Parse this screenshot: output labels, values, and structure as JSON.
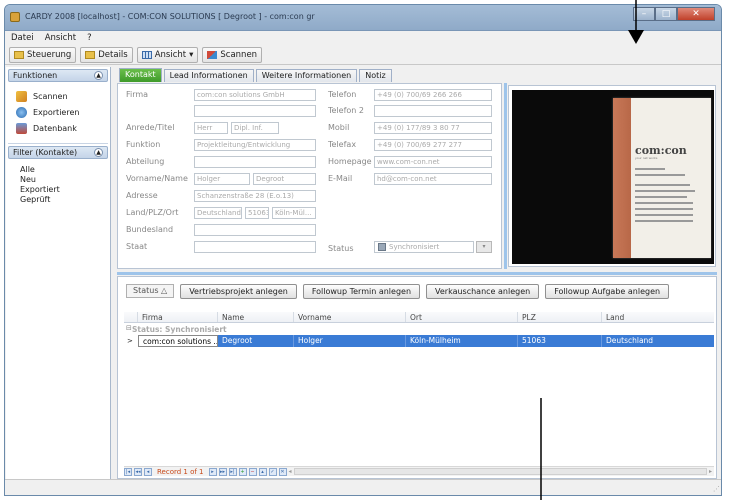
{
  "window": {
    "title": "CARDY 2008 [localhost] - COM:CON SOLUTIONS [ Degroot ] - com:con gr"
  },
  "menu": [
    "Datei",
    "Ansicht",
    "?"
  ],
  "toolbar": {
    "steuerung": "Steuerung",
    "details": "Details",
    "ansicht": "Ansicht",
    "scannen": "Scannen"
  },
  "sidebar": {
    "funktionen_header": "Funktionen",
    "items": [
      {
        "label": "Scannen",
        "icon": "scan-icon"
      },
      {
        "label": "Exportieren",
        "icon": "export-icon"
      },
      {
        "label": "Datenbank",
        "icon": "database-icon"
      }
    ],
    "filter_header": "Filter (Kontakte)",
    "filters": [
      "Alle",
      "Neu",
      "Exportiert",
      "Geprüft"
    ]
  },
  "tabs": [
    "Kontakt",
    "Lead Informationen",
    "Weitere Informationen",
    "Notiz"
  ],
  "form": {
    "labels": {
      "firma": "Firma",
      "anrede": "Anrede/Titel",
      "funktion": "Funktion",
      "abteilung": "Abteilung",
      "vorname": "Vorname/Name",
      "adresse": "Adresse",
      "land": "Land/PLZ/Ort",
      "bundesland": "Bundesland",
      "staat": "Staat",
      "telefon": "Telefon",
      "telefon2": "Telefon 2",
      "mobil": "Mobil",
      "telefax": "Telefax",
      "homepage": "Homepage",
      "email": "E-Mail",
      "status": "Status"
    },
    "values": {
      "firma": "com:con solutions GmbH",
      "anrede": "Herr",
      "titel": "Dipl. Inf.",
      "funktion": "Projektleitung/Entwicklung",
      "vorname": "Holger",
      "name": "Degroot",
      "adresse": "Schanzenstraße 28 (E.o.13)",
      "land": "Deutschland",
      "plz": "51063",
      "ort": "Köln-Mül...",
      "telefon": "+49 (0) 700/69 266 266",
      "mobil": "+49 (0) 177/89 3 80 77",
      "telefax": "+49 (0) 700/69 277 277",
      "homepage": "www.com-con.net",
      "email": "hd@com-con.net",
      "status": "Synchronisiert"
    }
  },
  "card": {
    "logo": "com:con",
    "tagline": "your net works"
  },
  "grid": {
    "status_button": "Status",
    "actions": [
      "Vertriebsprojekt anlegen",
      "Followup Termin anlegen",
      "Verkauschance anlegen",
      "Followup Aufgabe anlegen"
    ],
    "columns": [
      "Firma",
      "Name",
      "Vorname",
      "Ort",
      "PLZ",
      "Land"
    ],
    "group_label": "Status: Synchronisiert",
    "row": [
      "com:con solutions ...",
      "Degroot",
      "Holger",
      "Köln-Mülheim",
      "51063",
      "Deutschland"
    ],
    "record_label": "Record 1 of 1"
  }
}
